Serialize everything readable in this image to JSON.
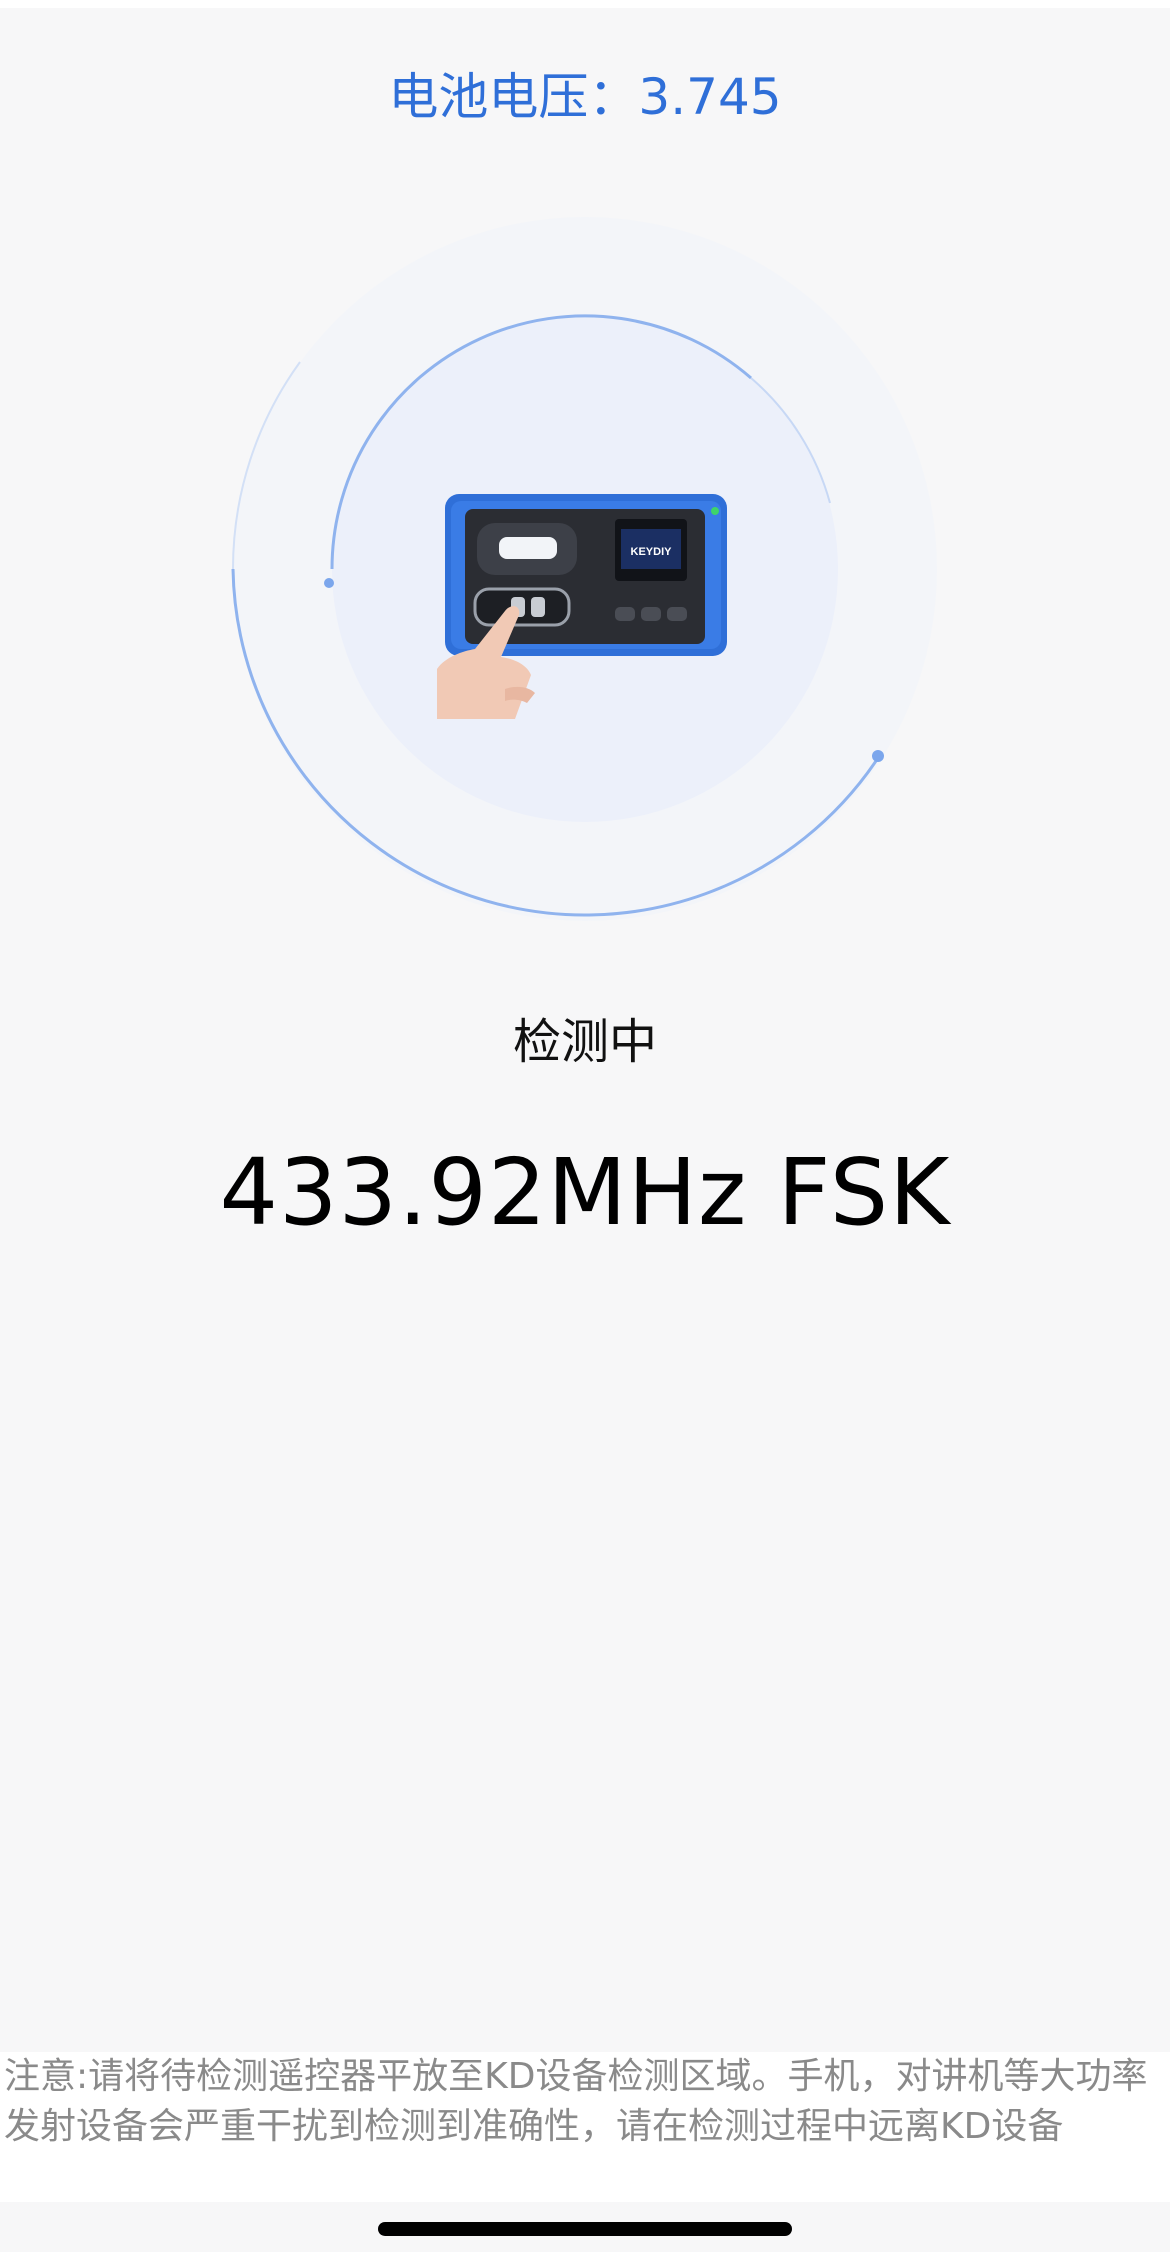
{
  "battery": {
    "label": "电池电压：",
    "value": "3.745",
    "color": "#2f6fd8"
  },
  "device_image": {
    "icon": "keydiy-kd-device-image",
    "screen_brand": "KEYDIY"
  },
  "status": {
    "text": "检测中"
  },
  "signal": {
    "frequency_text": "433.92MHz FSK"
  },
  "note": {
    "text": "注意:请将待检测遥控器平放至KD设备检测区域。手机，对讲机等大功率发射设备会严重干扰到检测到准确性，请在检测过程中远离KD设备"
  },
  "colors": {
    "accent": "#2f6fd8",
    "ring": "#8fb3ee",
    "background": "#f7f7f8",
    "device_blue": "#2f6fd8"
  }
}
